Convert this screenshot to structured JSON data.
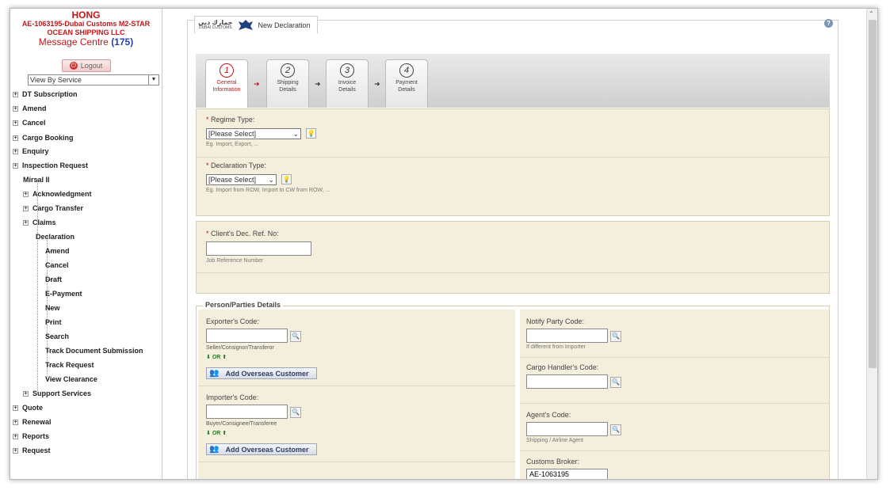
{
  "sidebar": {
    "user_name": "HONG",
    "user_line1": "AE-1063195-Dubai Customs M2-STAR",
    "user_line2": "OCEAN SHIPPING LLC",
    "message_centre": "Message Centre",
    "message_count": "(175)",
    "logout_label": "Logout",
    "view_select": "View By Service",
    "items": [
      {
        "label": "DT Subscription"
      },
      {
        "label": "Amend"
      },
      {
        "label": "Cancel"
      },
      {
        "label": "Cargo Booking"
      },
      {
        "label": "Enquiry"
      },
      {
        "label": "Inspection Request"
      },
      {
        "label": "Mirsal II"
      },
      {
        "label": "Acknowledgment"
      },
      {
        "label": "Cargo Transfer"
      },
      {
        "label": "Claims"
      },
      {
        "label": "Declaration"
      },
      {
        "label": "Amend"
      },
      {
        "label": "Cancel"
      },
      {
        "label": "Draft"
      },
      {
        "label": "E-Payment"
      },
      {
        "label": "New"
      },
      {
        "label": "Print"
      },
      {
        "label": "Search"
      },
      {
        "label": "Track Document Submission"
      },
      {
        "label": "Track Request"
      },
      {
        "label": "View Clearance"
      },
      {
        "label": "Support Services"
      },
      {
        "label": "Quote"
      },
      {
        "label": "Renewal"
      },
      {
        "label": "Reports"
      },
      {
        "label": "Request"
      }
    ]
  },
  "header": {
    "logo_arabic": "جمارك دبي",
    "logo_english": "DUBAI CUSTOMS",
    "title": "New Declaration",
    "help": "?"
  },
  "steps": [
    {
      "num": "1",
      "line1": "General",
      "line2": "Information"
    },
    {
      "num": "2",
      "line1": "Shipping",
      "line2": "Details"
    },
    {
      "num": "3",
      "line1": "Invoice",
      "line2": "Details"
    },
    {
      "num": "4",
      "line1": "Payment",
      "line2": "Details"
    }
  ],
  "form": {
    "regime_label": "Regime Type:",
    "regime_value": "[Please Select]",
    "regime_hint": "Eg. Import, Export, ...",
    "declaration_label": "Declaration Type:",
    "declaration_value": "[Please Select]",
    "declaration_hint": "Eg. Import from ROW, Import to CW from ROW, ...",
    "client_ref_label": "Client's Dec. Ref. No:",
    "client_ref_value": "",
    "client_ref_hint": "Job Reference Number",
    "required_mark": "*"
  },
  "parties": {
    "title": "Person/Parties Details",
    "exporter_label": "Exporter's Code:",
    "exporter_hint": "Seller/Consignor/Transferor",
    "or_label": "OR",
    "add_overseas": "Add Overseas Customer",
    "importer_label": "Importer's Code:",
    "importer_hint": "Buyer/Consignee/Transferee",
    "notify_label": "Notify Party Code:",
    "notify_hint": "If different from Importer",
    "cargo_handler_label": "Cargo Handler's Code:",
    "agent_label": "Agent's Code:",
    "agent_hint": "Shipping / Airline Agent",
    "broker_label": "Customs Broker:",
    "broker_value": "AE-1063195"
  },
  "colors": {
    "brand_red": "#c0171b",
    "panel_bg": "#f4eedc",
    "count_blue": "#1f3fbf"
  }
}
